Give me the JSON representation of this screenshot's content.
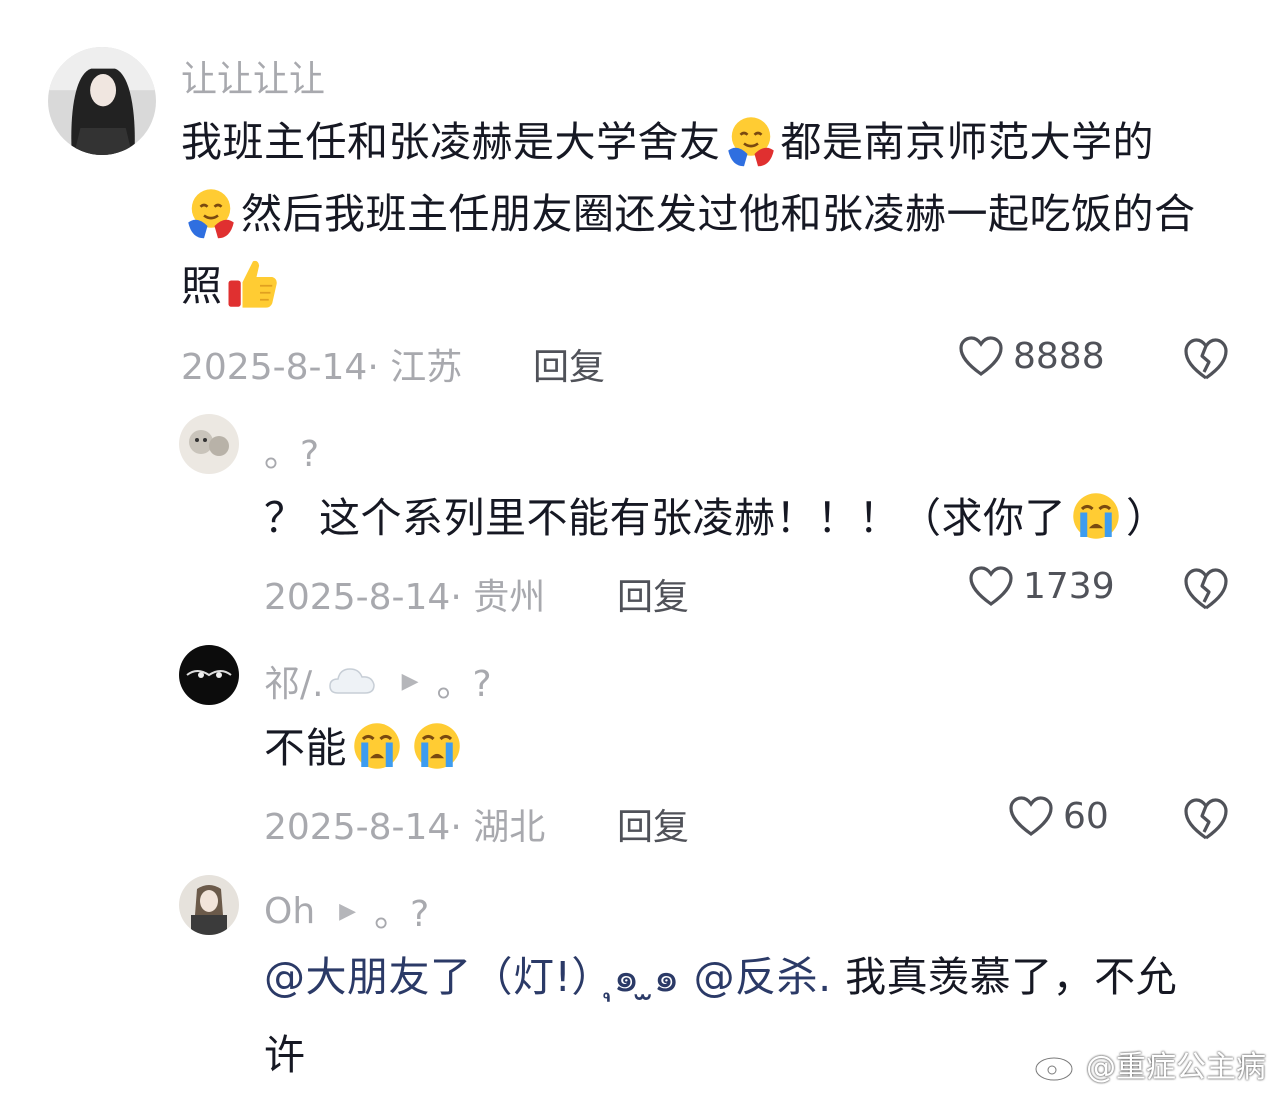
{
  "comments": [
    {
      "username": "让让让让",
      "text_1": "我班主任和张凌赫是大学舍友",
      "emoji_1": "hugging-face-emoji",
      "text_2": "都是南京师范大学的",
      "emoji_2": "hugging-face-emoji",
      "text_3": "然后我班主任朋友圈还发过他和张凌赫一起吃饭的合照",
      "emoji_3": "thumbs-up-emoji",
      "date": "2025-8-14",
      "location": "江苏",
      "reply_label": "回复",
      "likes": "8888"
    },
    {
      "username": "。?",
      "text_1": "？ 这个系列里不能有张凌赫！！！（求你了",
      "emoji_1": "loudly-crying-face-emoji",
      "text_2": "）",
      "date": "2025-8-14",
      "location": "贵州",
      "reply_label": "回复",
      "likes": "1739"
    },
    {
      "username": "祁/.",
      "username_icon": "cloud-emoji",
      "reply_to": "。?",
      "text_1": "不能",
      "emoji_1": "loudly-crying-face-emoji",
      "emoji_2": "loudly-crying-face-emoji",
      "date": "2025-8-14",
      "location": "湖北",
      "reply_label": "回复",
      "likes": "60"
    },
    {
      "username": "Oh",
      "reply_to": "。?",
      "mention_1": "@大朋友了（灯!）ุ๑ ̫๑",
      "mention_2": "@反杀.",
      "text_1": " 我真羡慕了，不允许"
    }
  ],
  "watermark": "@重症公主病",
  "colors": {
    "primary_text": "#161823",
    "secondary_text": "#a8a9ae",
    "mention": "#2b3a67"
  }
}
